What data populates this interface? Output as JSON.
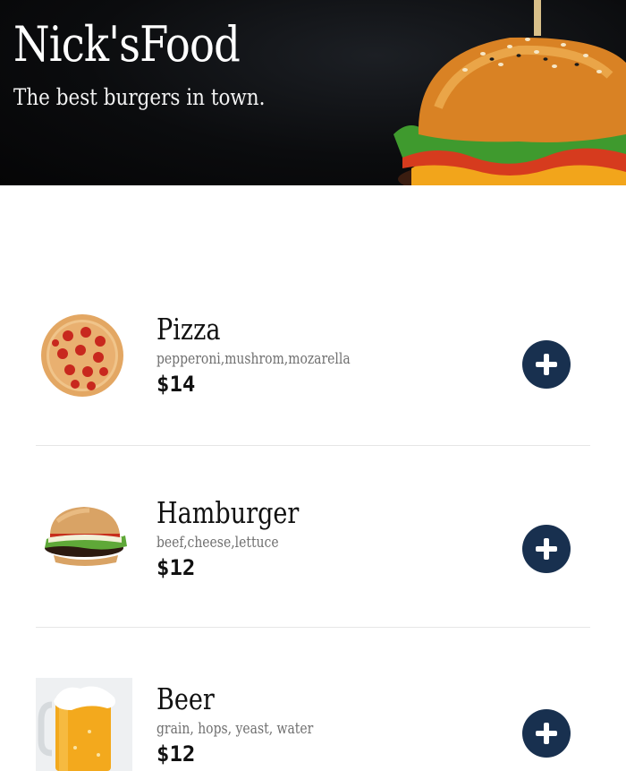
{
  "header": {
    "title": "Nick'sFood",
    "subtitle": "The best burgers in town."
  },
  "menu": {
    "items": [
      {
        "name": "Pizza",
        "ingredients": "pepperoni,mushrom,mozarella",
        "price": "$14",
        "icon": "pizza-image"
      },
      {
        "name": "Hamburger",
        "ingredients": "beef,cheese,lettuce",
        "price": "$12",
        "icon": "hamburger-image"
      },
      {
        "name": "Beer",
        "ingredients": "grain, hops, yeast, water",
        "price": "$12",
        "icon": "beer-image"
      }
    ],
    "add_icon": "plus-icon",
    "button_color": "#18304f"
  }
}
